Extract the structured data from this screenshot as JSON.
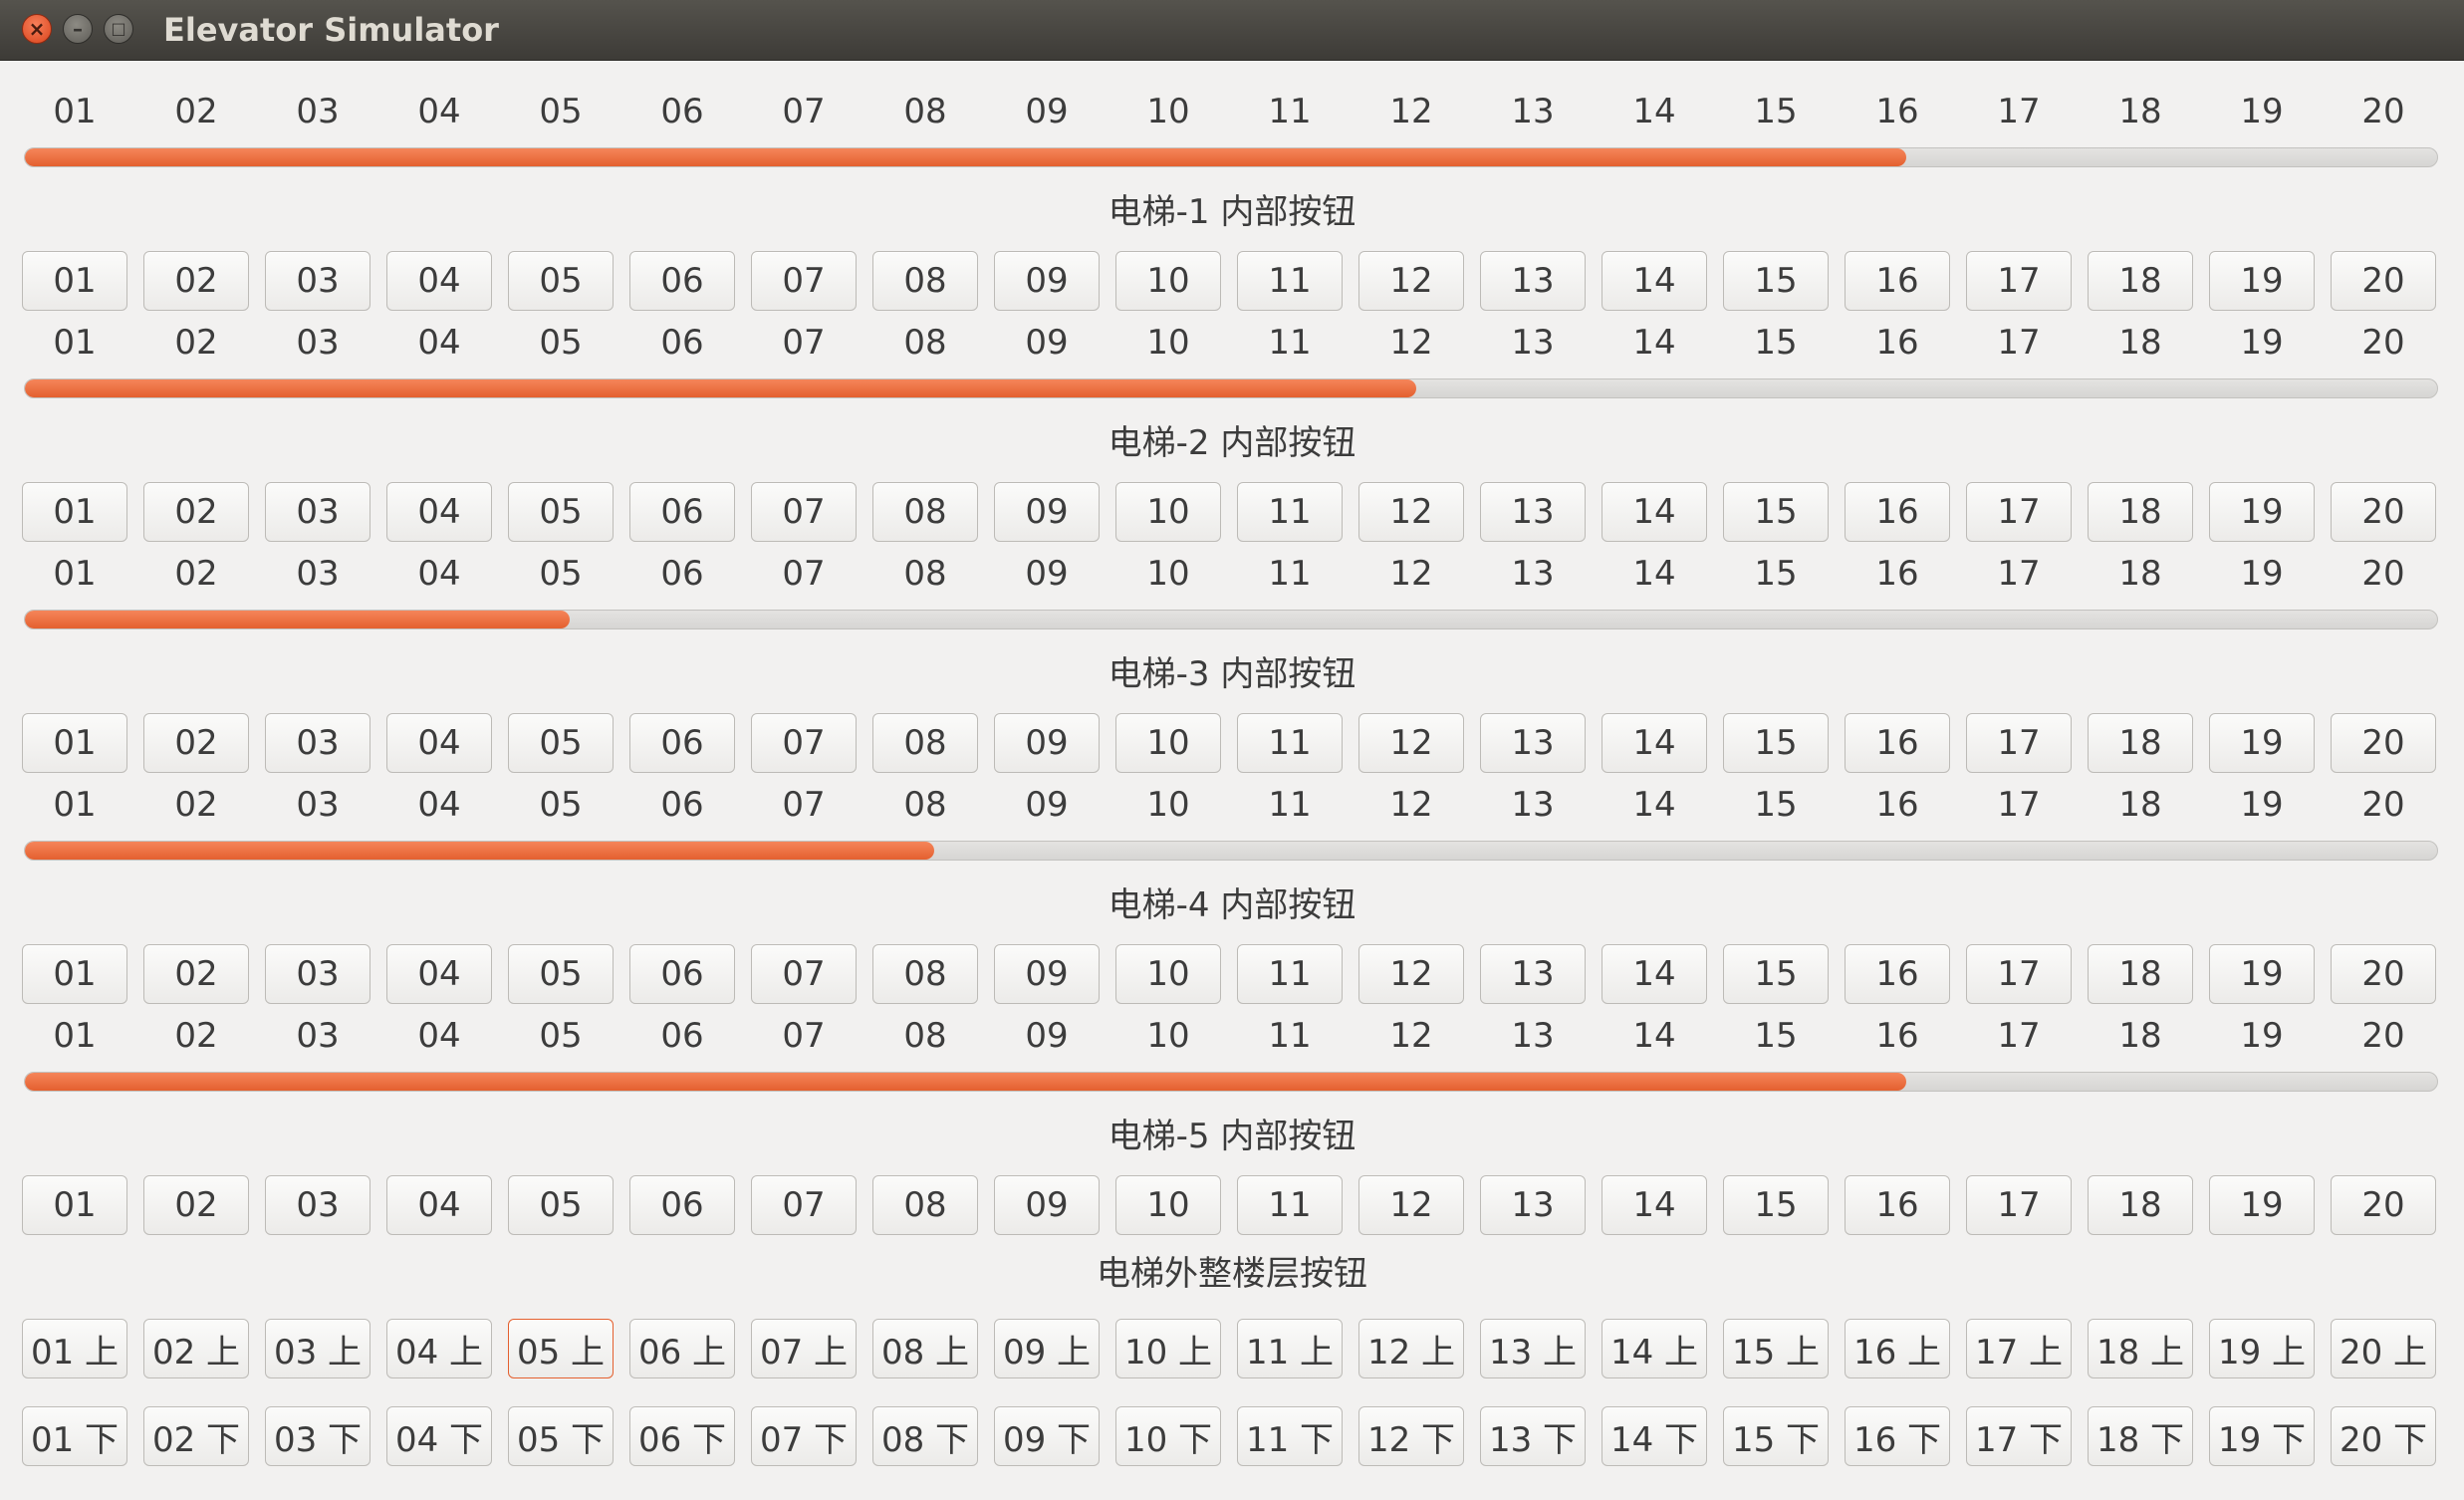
{
  "window": {
    "title": "Elevator Simulator",
    "close_icon": "close-icon",
    "minimize_icon": "minimize-icon",
    "maximize_icon": "maximize-icon"
  },
  "floors": [
    "01",
    "02",
    "03",
    "04",
    "05",
    "06",
    "07",
    "08",
    "09",
    "10",
    "11",
    "12",
    "13",
    "14",
    "15",
    "16",
    "17",
    "18",
    "19",
    "20"
  ],
  "elevators": [
    {
      "label": "电梯-1 内部按钮",
      "progress": 0.78
    },
    {
      "label": "电梯-2 内部按钮",
      "progress": 0.577
    },
    {
      "label": "电梯-3 内部按钮",
      "progress": 0.226
    },
    {
      "label": "电梯-4 内部按钮",
      "progress": 0.377
    },
    {
      "label": "电梯-5 内部按钮",
      "progress": 0.78
    }
  ],
  "outside": {
    "label": "电梯外整楼层按钮",
    "up_suffix": "上",
    "down_suffix": "下",
    "focused_up_floor": "05"
  },
  "colors": {
    "accent": "#e4602f",
    "background": "#f2f1f0",
    "titlebar": "#3d3b37"
  }
}
